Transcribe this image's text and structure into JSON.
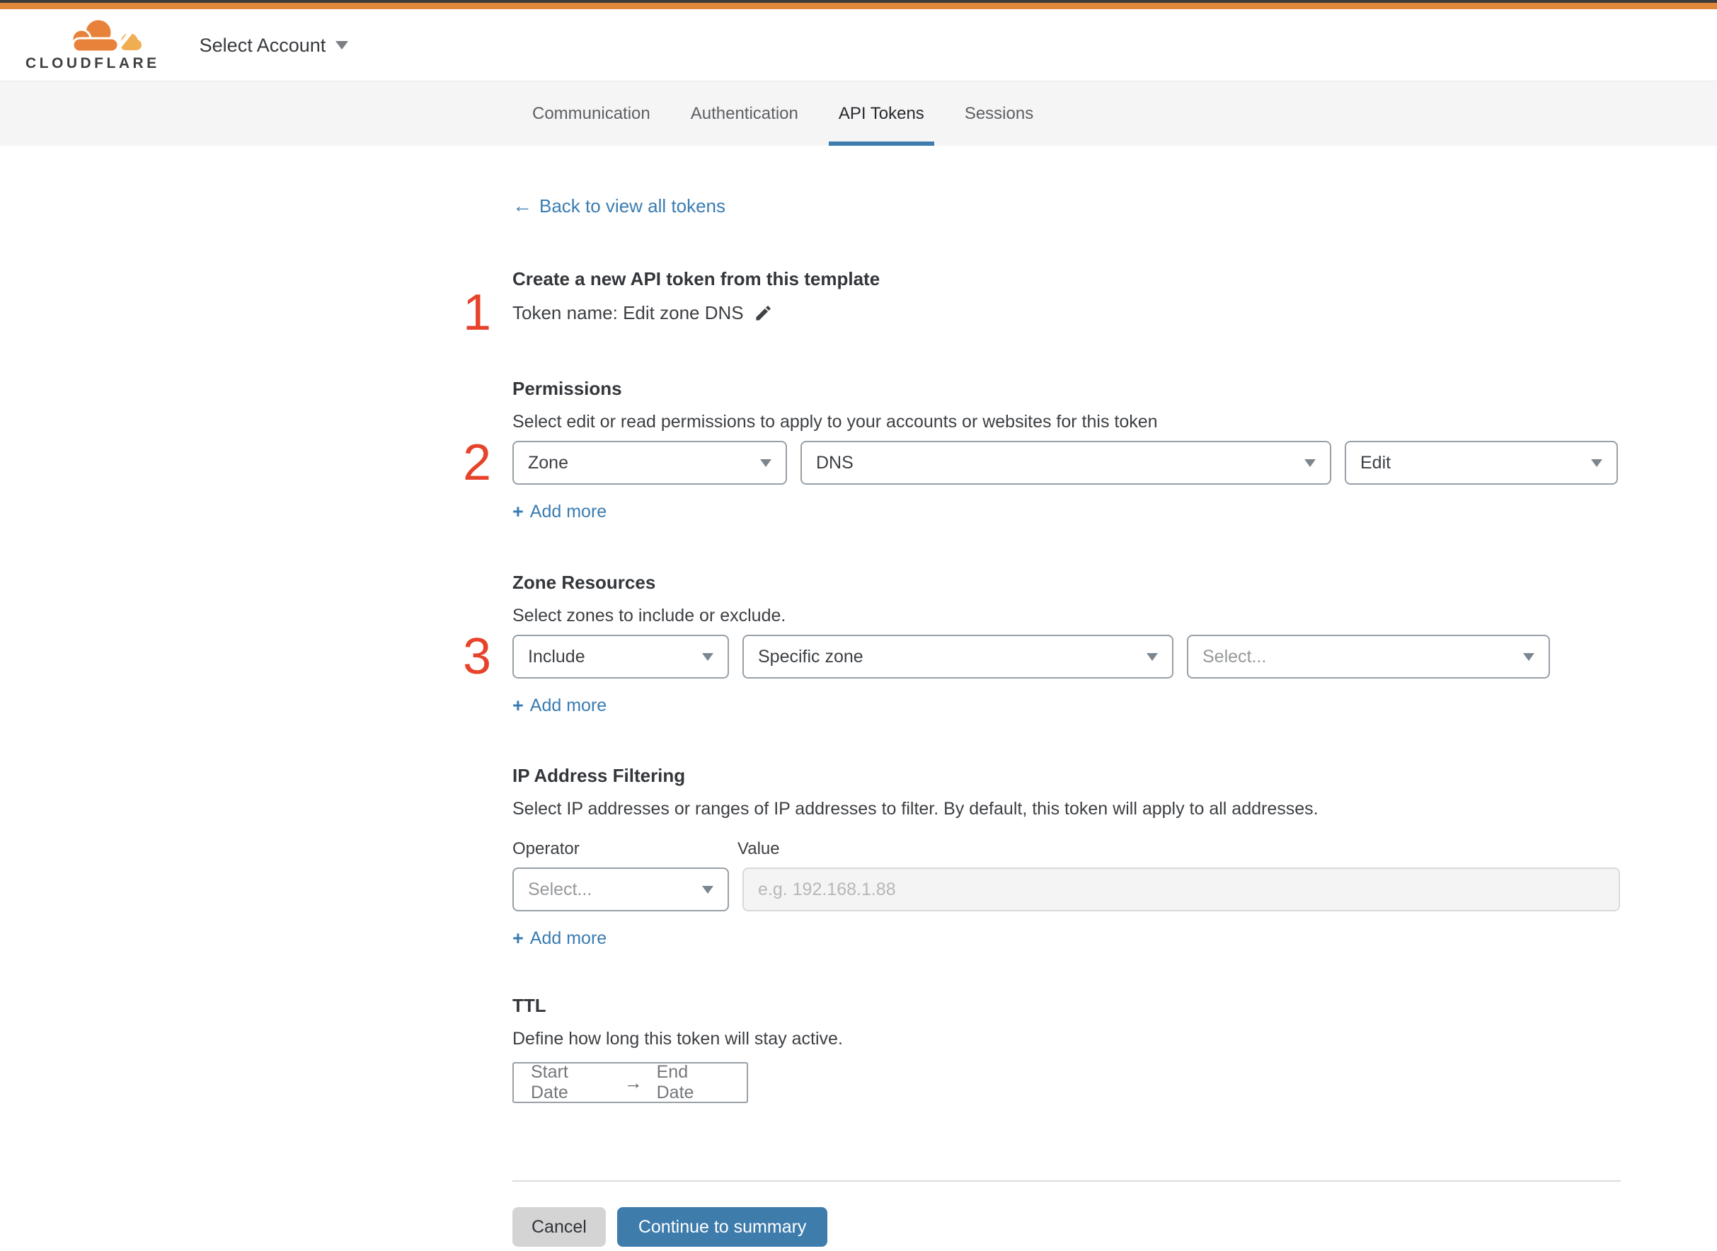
{
  "header": {
    "brand": "CLOUDFLARE",
    "account_selector": "Select Account"
  },
  "tabs": [
    {
      "label": "Communication",
      "active": false
    },
    {
      "label": "Authentication",
      "active": false
    },
    {
      "label": "API Tokens",
      "active": true
    },
    {
      "label": "Sessions",
      "active": false
    }
  ],
  "back": {
    "arrow": "←",
    "label": "Back to view all tokens"
  },
  "steps": {
    "one": "1",
    "two": "2",
    "three": "3"
  },
  "template_section": {
    "title": "Create a new API token from this template",
    "token_name": "Token name: Edit zone DNS"
  },
  "permissions": {
    "heading": "Permissions",
    "description": "Select edit or read permissions to apply to your accounts or websites for this token",
    "scope_value": "Zone",
    "service_value": "DNS",
    "access_value": "Edit",
    "plus": "+",
    "add_more": "Add more"
  },
  "zone_resources": {
    "heading": "Zone Resources",
    "description": "Select zones to include or exclude.",
    "mode_value": "Include",
    "type_value": "Specific zone",
    "zone_placeholder": "Select...",
    "plus": "+",
    "add_more": "Add more"
  },
  "ip_filtering": {
    "heading": "IP Address Filtering",
    "description": "Select IP addresses or ranges of IP addresses to filter. By default, this token will apply to all addresses.",
    "operator_label": "Operator",
    "value_label": "Value",
    "operator_placeholder": "Select...",
    "value_placeholder": "e.g. 192.168.1.88",
    "plus": "+",
    "add_more": "Add more"
  },
  "ttl": {
    "heading": "TTL",
    "description": "Define how long this token will stay active.",
    "start_label": "Start Date",
    "arrow": "→",
    "end_label": "End Date"
  },
  "footer": {
    "cancel": "Cancel",
    "continue": "Continue to summary"
  },
  "colors": {
    "top_bar_orange": "#e0873c",
    "logo_orange": "#e8813a",
    "logo_light_orange": "#f1ad52",
    "link_blue": "#3a7cb1",
    "active_tab_underline": "#3e7cad",
    "step_number_red": "#e7432b",
    "continue_button_blue": "#3e7cac",
    "cancel_button_gray": "#d4d4d5",
    "tabbar_gray": "#f5f5f6"
  }
}
